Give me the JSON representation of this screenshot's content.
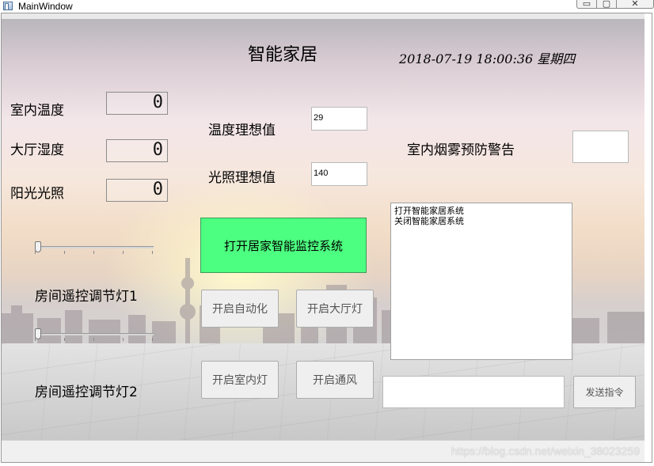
{
  "window": {
    "title": "MainWindow",
    "controls": {
      "minimize": "▭",
      "maximize": "▢",
      "close": "✕"
    }
  },
  "header": {
    "app_title": "智能家居",
    "datetime": "2018-07-19 18:00:36 星期四"
  },
  "sensors": [
    {
      "label": "室内温度",
      "value": "0"
    },
    {
      "label": "大厅湿度",
      "value": "0"
    },
    {
      "label": "阳光光照",
      "value": "0"
    }
  ],
  "thresholds": {
    "temperature_label": "温度理想值",
    "temperature_value": "29",
    "light_label": "光照理想值",
    "light_value": "140"
  },
  "smoke": {
    "label": "室内烟雾预防警告",
    "value": ""
  },
  "main_button": {
    "label": "打开居家智能监控系统",
    "color": "#4dff80"
  },
  "controls": {
    "auto": "开启自动化",
    "hall_light": "开启大厅灯",
    "indoor_light": "开启室内灯",
    "ventilation": "开启通风"
  },
  "lights": {
    "room1_label": "房间遥控调节灯1",
    "room1_level": 0,
    "room2_label": "房间遥控调节灯2",
    "room2_level": 0
  },
  "log": {
    "lines": [
      "打开智能家居系统",
      "关闭智能家居系统"
    ]
  },
  "command": {
    "input_value": "",
    "send_label": "发送指令"
  },
  "watermark": "https://blog.csdn.net/weixin_38023259"
}
